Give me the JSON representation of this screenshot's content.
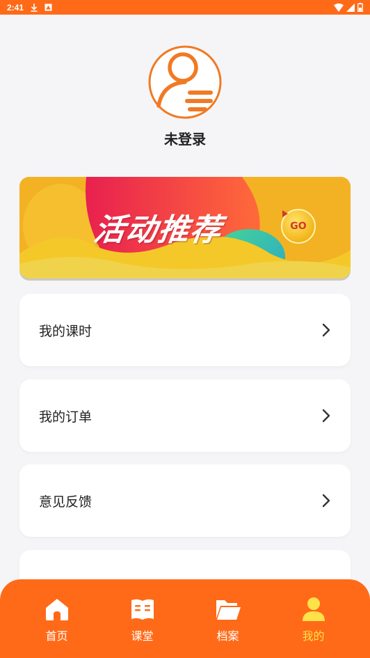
{
  "status_bar": {
    "time": "2:41"
  },
  "profile": {
    "username": "未登录"
  },
  "banner": {
    "title": "活动推荐",
    "go_label": "GO"
  },
  "menu": [
    {
      "label": "我的课时",
      "icon": "chevron-right-icon"
    },
    {
      "label": "我的订单",
      "icon": "chevron-right-icon"
    },
    {
      "label": "意见反馈",
      "icon": "chevron-right-icon"
    },
    {
      "label": "",
      "icon": "chevron-right-icon"
    }
  ],
  "bottom_nav": {
    "items": [
      {
        "label": "首页",
        "icon": "home-icon",
        "active": false
      },
      {
        "label": "课堂",
        "icon": "book-icon",
        "active": false
      },
      {
        "label": "档案",
        "icon": "folder-icon",
        "active": false
      },
      {
        "label": "我的",
        "icon": "user-icon",
        "active": true
      }
    ]
  },
  "colors": {
    "accent": "#ff6a18",
    "active_tab": "#ffe14a"
  }
}
